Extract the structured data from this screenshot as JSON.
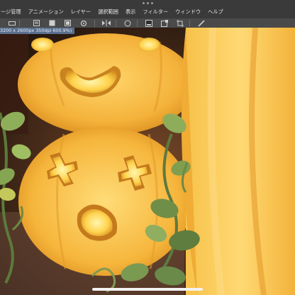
{
  "menubar": {
    "items": [
      "ージ管理",
      "アニメーション",
      "レイヤー",
      "選択範囲",
      "表示",
      "フィルター",
      "ウィンドウ",
      "ヘルプ"
    ]
  },
  "toolbar": {
    "icons": [
      "ruler-icon",
      "copy-icon",
      "paste-icon",
      "fill-icon",
      "settings-icon",
      "transform-icon",
      "ellipse-icon",
      "clear-icon",
      "fill-selection-icon",
      "crop-icon",
      "pen-icon"
    ]
  },
  "document": {
    "tab_label": "3200 x 2600px 350dpi 600.9%)"
  },
  "colors": {
    "menubar_bg": "#3a3a3a",
    "toolbar_bg": "#4a4a4a",
    "tab_bg": "#5a6f8e",
    "pumpkin": "#f7b83a",
    "background": "#2b1c14"
  }
}
